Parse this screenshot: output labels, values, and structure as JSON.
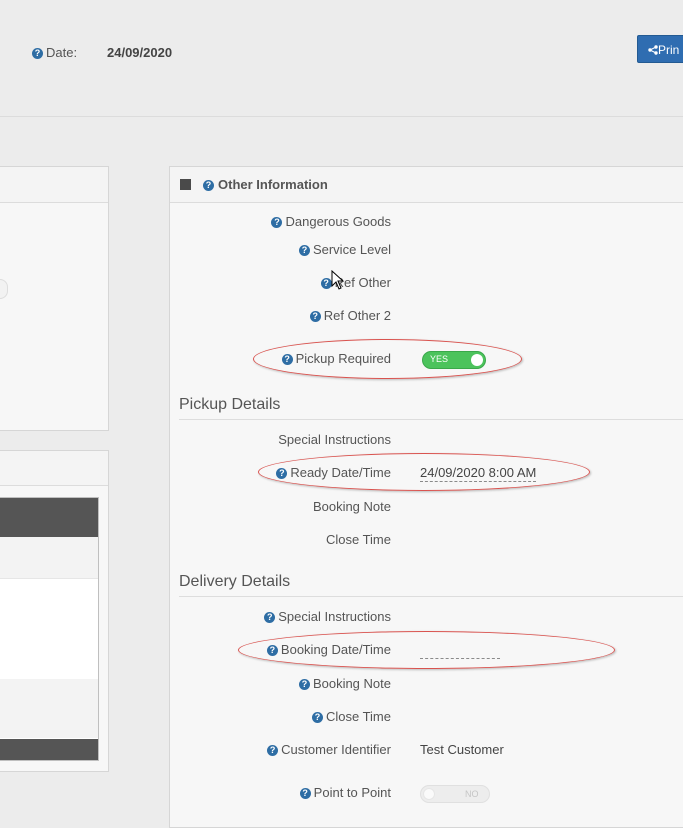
{
  "header": {
    "date_label": "Date:",
    "date_value": "24/09/2020",
    "print_button_label": "Prin"
  },
  "other_information": {
    "title": "Other Information",
    "fields": {
      "dangerous_goods": "Dangerous Goods",
      "service_level": "Service Level",
      "ref_other": "Ref Other",
      "ref_other_2": "Ref Other 2",
      "pickup_required": "Pickup Required",
      "pickup_required_toggle": "YES"
    }
  },
  "pickup_details": {
    "title": "Pickup Details",
    "special_instructions": "Special Instructions",
    "ready_datetime_label": "Ready Date/Time",
    "ready_datetime_value": "24/09/2020 8:00 AM",
    "booking_note": "Booking Note",
    "close_time": "Close Time"
  },
  "delivery_details": {
    "title": "Delivery Details",
    "special_instructions": "Special Instructions",
    "booking_datetime_label": "Booking Date/Time",
    "booking_datetime_value": "",
    "booking_note": "Booking Note",
    "close_time": "Close Time",
    "customer_identifier_label": "Customer Identifier",
    "customer_identifier_value": "Test Customer",
    "point_to_point_label": "Point to Point",
    "point_to_point_toggle": "NO"
  },
  "colors": {
    "accent": "#2f6db1",
    "toggle_on": "#4cc35c",
    "annotation": "#d9534f"
  },
  "icons": [
    "help-icon",
    "share-icon",
    "collapse-icon",
    "cursor-icon"
  ]
}
